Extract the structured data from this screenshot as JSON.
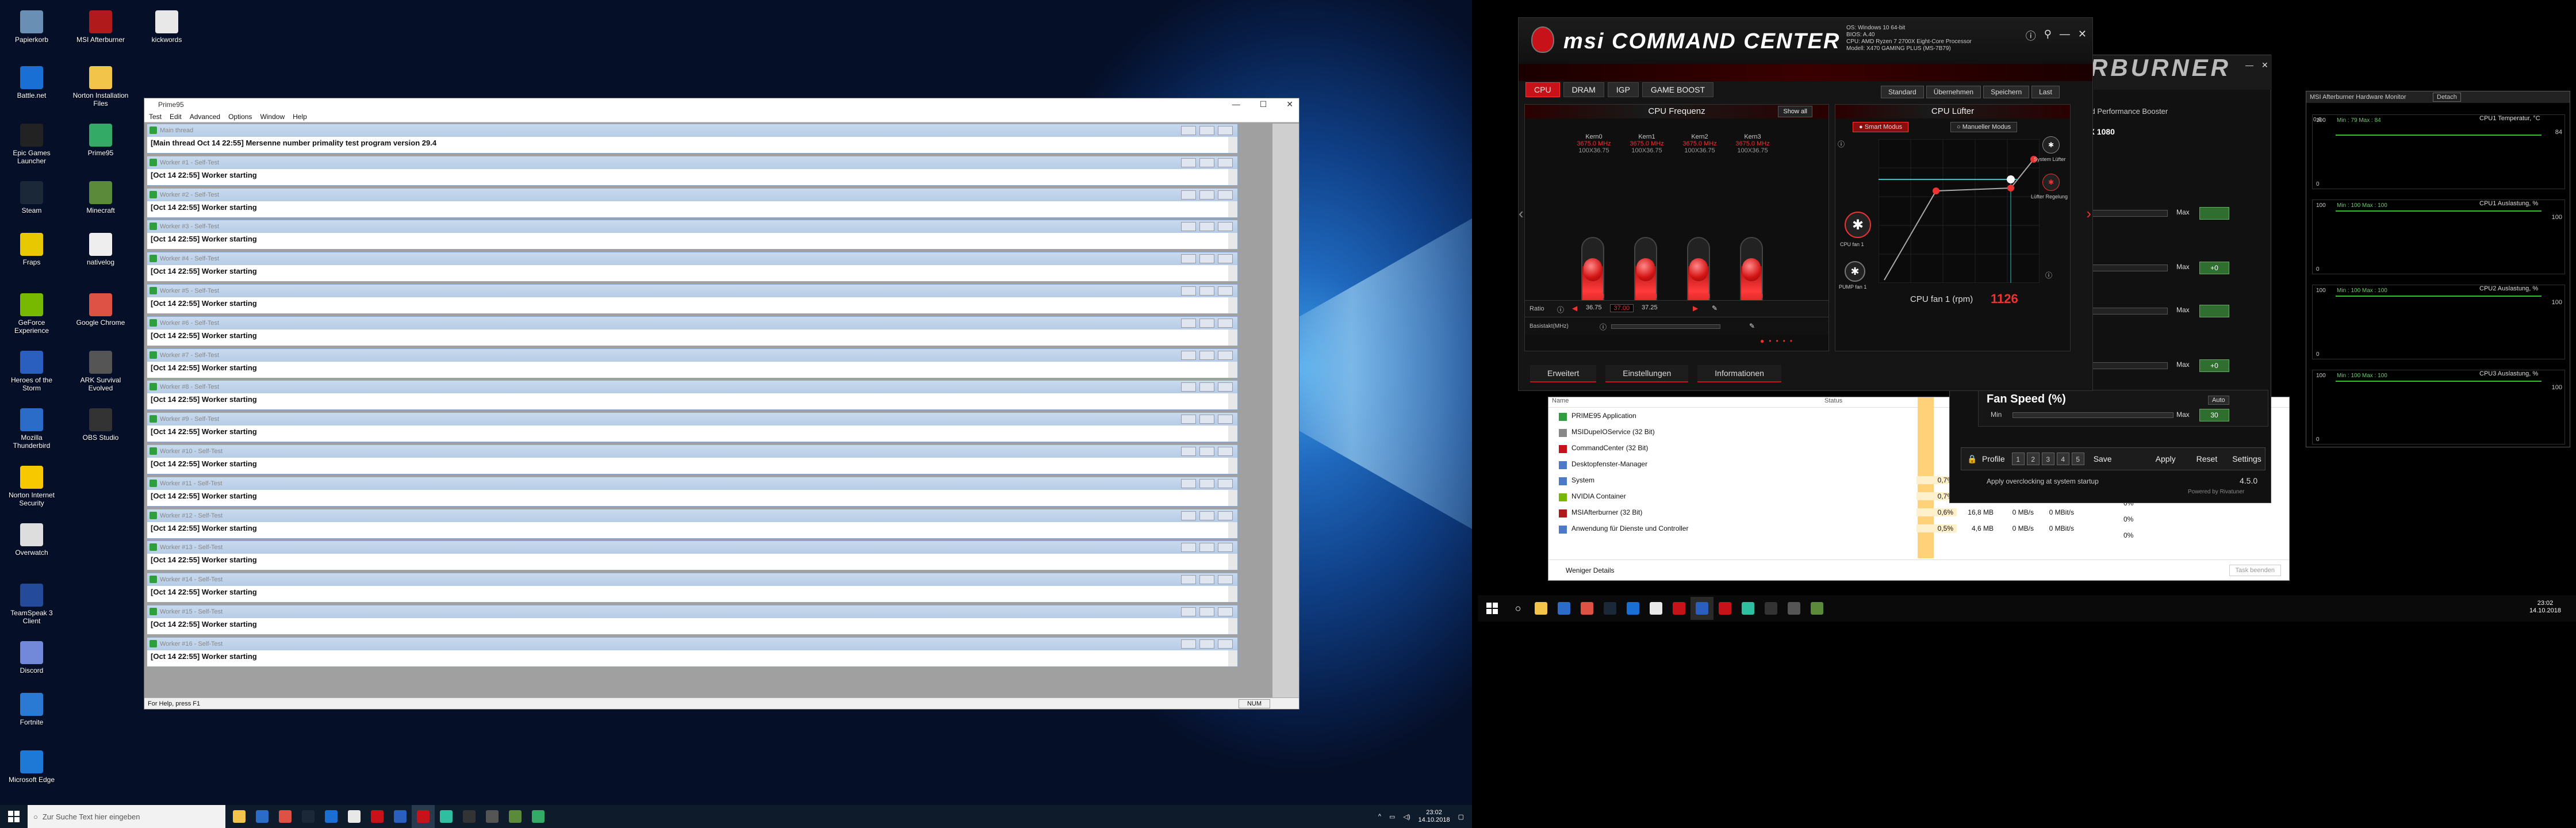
{
  "desktop_icons": [
    {
      "label": "Papierkorb",
      "icon": "recycle-bin-icon",
      "color": "#6a8fb5"
    },
    {
      "label": "MSI Afterburner",
      "icon": "afterburner-icon",
      "color": "#b01a1a"
    },
    {
      "label": "kickwords",
      "icon": "text-file-icon",
      "color": "#e8e8e8"
    },
    {
      "label": "Battle.net",
      "icon": "battlenet-icon",
      "color": "#1a6fd4"
    },
    {
      "label": "Norton Installation Files",
      "icon": "folder-icon",
      "color": "#f3c44a"
    },
    {
      "label": "Epic Games Launcher",
      "icon": "epic-icon",
      "color": "#222"
    },
    {
      "label": "Prime95",
      "icon": "prime95-icon",
      "color": "#3a6"
    },
    {
      "label": "Steam",
      "icon": "steam-icon",
      "color": "#1b2838"
    },
    {
      "label": "Minecraft",
      "icon": "minecraft-icon",
      "color": "#5a8a3a"
    },
    {
      "label": "Fraps",
      "icon": "fraps-icon",
      "color": "#e8c800"
    },
    {
      "label": "nativelog",
      "icon": "text-file-icon",
      "color": "#eee"
    },
    {
      "label": "GeForce Experience",
      "icon": "geforce-icon",
      "color": "#76b900"
    },
    {
      "label": "Google Chrome",
      "icon": "chrome-icon",
      "color": "#de5246"
    },
    {
      "label": "Heroes of the Storm",
      "icon": "hots-icon",
      "color": "#2a5fc0"
    },
    {
      "label": "ARK Survival Evolved",
      "icon": "ark-icon",
      "color": "#555"
    },
    {
      "label": "Mozilla Thunderbird",
      "icon": "thunderbird-icon",
      "color": "#2a6cc8"
    },
    {
      "label": "OBS Studio",
      "icon": "obs-icon",
      "color": "#333"
    },
    {
      "label": "Norton Internet Security",
      "icon": "norton-icon",
      "color": "#f7c800"
    },
    {
      "label": "Overwatch",
      "icon": "overwatch-icon",
      "color": "#ddd"
    },
    {
      "label": "TeamSpeak 3 Client",
      "icon": "teamspeak-icon",
      "color": "#234b9a"
    },
    {
      "label": "Discord",
      "icon": "discord-icon",
      "color": "#7289da"
    },
    {
      "label": "Fortnite",
      "icon": "fortnite-icon",
      "color": "#2a7ad4"
    },
    {
      "label": "Microsoft Edge",
      "icon": "edge-icon",
      "color": "#1e78d6"
    }
  ],
  "prime95": {
    "title": "Prime95",
    "menu": [
      "Test",
      "Edit",
      "Advanced",
      "Options",
      "Window",
      "Help"
    ],
    "main_title": "Main thread",
    "main_line": "[Main thread Oct 14 22:55] Mersenne number primality test program version 29.4",
    "workers": [
      {
        "title": "Worker #1 - Self-Test",
        "line": "[Oct 14 22:55] Worker starting"
      },
      {
        "title": "Worker #2 - Self-Test",
        "line": "[Oct 14 22:55] Worker starting"
      },
      {
        "title": "Worker #3 - Self-Test",
        "line": "[Oct 14 22:55] Worker starting"
      },
      {
        "title": "Worker #4 - Self-Test",
        "line": "[Oct 14 22:55] Worker starting"
      },
      {
        "title": "Worker #5 - Self-Test",
        "line": "[Oct 14 22:55] Worker starting"
      },
      {
        "title": "Worker #6 - Self-Test",
        "line": "[Oct 14 22:55] Worker starting"
      },
      {
        "title": "Worker #7 - Self-Test",
        "line": "[Oct 14 22:55] Worker starting"
      },
      {
        "title": "Worker #8 - Self-Test",
        "line": "[Oct 14 22:55] Worker starting"
      },
      {
        "title": "Worker #9 - Self-Test",
        "line": "[Oct 14 22:55] Worker starting"
      },
      {
        "title": "Worker #10 - Self-Test",
        "line": "[Oct 14 22:55] Worker starting"
      },
      {
        "title": "Worker #11 - Self-Test",
        "line": "[Oct 14 22:55] Worker starting"
      },
      {
        "title": "Worker #12 - Self-Test",
        "line": "[Oct 14 22:55] Worker starting"
      },
      {
        "title": "Worker #13 - Self-Test",
        "line": "[Oct 14 22:55] Worker starting"
      },
      {
        "title": "Worker #14 - Self-Test",
        "line": "[Oct 14 22:55] Worker starting"
      },
      {
        "title": "Worker #15 - Self-Test",
        "line": "[Oct 14 22:55] Worker starting"
      },
      {
        "title": "Worker #16 - Self-Test",
        "line": "[Oct 14 22:55] Worker starting"
      }
    ],
    "status_left": "For Help, press F1",
    "status_right": "NUM"
  },
  "msi": {
    "brand": "msi COMMAND CENTER",
    "sysinfo": [
      "OS: Windows 10 64-bit",
      "BIOS: A.40",
      "CPU: AMD Ryzen 7 2700X Eight-Core Processor",
      "Modell: X470 GAMING PLUS (MS-7B79)"
    ],
    "tabs": [
      "CPU",
      "DRAM",
      "IGP",
      "GAME BOOST"
    ],
    "tabs2": [
      "Standard",
      "Übernehmen",
      "Speichern",
      "Last"
    ],
    "freq_title": "CPU Frequenz",
    "show_all": "Show all",
    "cores": [
      {
        "name": "Kern0",
        "mhz": "3675.0 MHz",
        "sub": "100X36.75",
        "ghz": "x37.00",
        "level": 0.62
      },
      {
        "name": "Kern1",
        "mhz": "3675.0 MHz",
        "sub": "100X36.75",
        "ghz": "x37.00",
        "level": 0.62
      },
      {
        "name": "Kern2",
        "mhz": "3675.0 MHz",
        "sub": "100X36.75",
        "ghz": "x37.00",
        "level": 0.62
      },
      {
        "name": "Kern3",
        "mhz": "3675.0 MHz",
        "sub": "100X36.75",
        "ghz": "x37.00",
        "level": 0.62
      }
    ],
    "ratio_label": "Ratio",
    "ratio_values": [
      "36.75",
      "37.00",
      "37.25"
    ],
    "bclk_label": "Basistakt(MHz)",
    "fan_title": "CPU Lüfter",
    "fan_modes": [
      "Smart Modus",
      "Manueller Modus"
    ],
    "fan_labels": [
      "CPU fan 1",
      "PUMP fan 1"
    ],
    "fan_side": [
      "System Lüfter",
      "Lüfter Regelung"
    ],
    "fan_rpm_label": "CPU fan 1 (rpm)",
    "fan_rpm": "1126",
    "bottom": [
      "Erweitert",
      "Einstellungen",
      "Informationen"
    ]
  },
  "task_manager": {
    "col_name": "Name",
    "col_status": "Status",
    "rows": [
      {
        "name": "PRIME95 Application",
        "cpu": "",
        "mem": "",
        "disk": "",
        "net": "",
        "icon": "#2e9e3e"
      },
      {
        "name": "MSIDupeIOService (32 Bit)",
        "cpu": "",
        "mem": "",
        "disk": "",
        "net": "",
        "icon": "#888"
      },
      {
        "name": "CommandCenter (32 Bit)",
        "cpu": "",
        "mem": "",
        "disk": "",
        "net": "",
        "icon": "#c8121a"
      },
      {
        "name": "Desktopfenster-Manager",
        "cpu": "",
        "mem": "",
        "disk": "",
        "net": "",
        "icon": "#4a7ac8"
      },
      {
        "name": "System",
        "cpu": "0,7%",
        "mem": "",
        "disk": "",
        "net": "",
        "icon": "#4a7ac8"
      },
      {
        "name": "NVIDIA Container",
        "cpu": "0,7%",
        "mem": "2,3 MB",
        "disk": "0,1 MB/s",
        "net": "0 MBit/s",
        "icon": "#76b900"
      },
      {
        "name": "MSIAfterburner (32 Bit)",
        "cpu": "0,6%",
        "mem": "16,8 MB",
        "disk": "0 MB/s",
        "net": "0 MBit/s",
        "icon": "#b01a1a"
      },
      {
        "name": "Anwendung für Dienste und Controller",
        "cpu": "0,5%",
        "mem": "4,6 MB",
        "disk": "0 MB/s",
        "net": "0 MBit/s",
        "icon": "#4a7ac8"
      }
    ],
    "net_pct": [
      "0%",
      "0%",
      "0%"
    ],
    "footer": "Weniger Details",
    "end_task": "Task beenden"
  },
  "afterburner": {
    "title": "RBURNER",
    "tab": "ard Performance Booster",
    "gpu": "TX 1080",
    "max": "Max",
    "green_values": [
      "",
      "+0",
      "",
      "+0"
    ],
    "fan_title": "Fan Speed (%)",
    "fan_min": "Min",
    "fan_auto": "Auto",
    "fan_value": "30",
    "profile_label": "Profile",
    "profile_slots": [
      "1",
      "2",
      "3",
      "4",
      "5"
    ],
    "save": "Save",
    "apply": "Apply",
    "reset": "Reset",
    "settings": "Settings",
    "startup": "Apply overclocking at system startup",
    "version": "4.5.0",
    "powered": "Powered by Rivatuner"
  },
  "hw_monitor": {
    "title": "MSI Afterburner Hardware Monitor",
    "detach": "Detach",
    "graphs": [
      {
        "label": "CPU1 Temperatur, °C",
        "top": "100",
        "zero": "0",
        "minmax": "Min : 79  Max : 84",
        "value": "84",
        "level": 0.84
      },
      {
        "label": "CPU1 Auslastung, %",
        "top": "100",
        "zero": "0",
        "minmax": "Min : 100  Max : 100",
        "value": "100",
        "level": 1.0
      },
      {
        "label": "CPU2 Auslastung, %",
        "top": "100",
        "zero": "0",
        "minmax": "Min : 100  Max : 100",
        "value": "100",
        "level": 1.0
      },
      {
        "label": "CPU3 Auslastung, %",
        "top": "100",
        "zero": "0",
        "minmax": "Min : 100  Max : 100",
        "value": "100",
        "level": 1.0
      }
    ],
    "scale_top": "0.6"
  },
  "taskbar": {
    "search_placeholder": "Zur Suche Text hier eingeben",
    "time": "23:02",
    "date": "14.10.2018",
    "time2": "23:02",
    "date2": "14.10.2018"
  }
}
